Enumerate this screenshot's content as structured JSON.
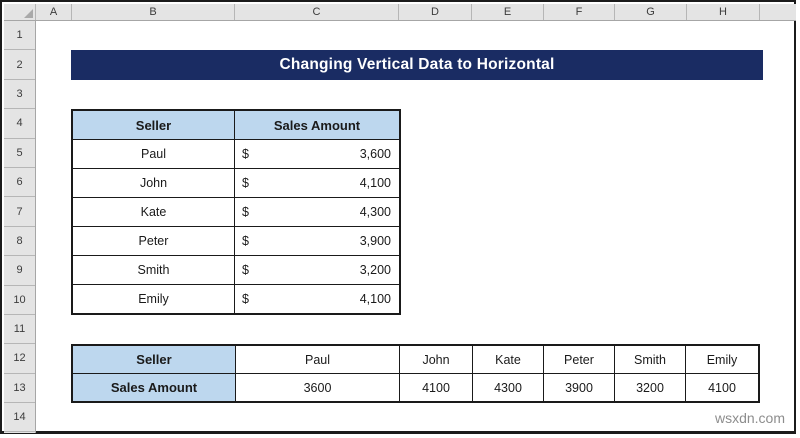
{
  "sheet": {
    "column_headers": [
      "A",
      "B",
      "C",
      "D",
      "E",
      "F",
      "G",
      "H",
      ""
    ],
    "row_headers": [
      "1",
      "2",
      "3",
      "4",
      "5",
      "6",
      "7",
      "8",
      "9",
      "10",
      "11",
      "12",
      "13",
      "14"
    ],
    "title_banner": {
      "text": "Changing Vertical Data to Horizontal"
    },
    "vertical_table": {
      "headers": [
        "Seller",
        "Sales Amount"
      ],
      "rows": [
        {
          "seller": "Paul",
          "currency": "$",
          "amount": "3,600"
        },
        {
          "seller": "John",
          "currency": "$",
          "amount": "4,100"
        },
        {
          "seller": "Kate",
          "currency": "$",
          "amount": "4,300"
        },
        {
          "seller": "Peter",
          "currency": "$",
          "amount": "3,900"
        },
        {
          "seller": "Smith",
          "currency": "$",
          "amount": "3,200"
        },
        {
          "seller": "Emily",
          "currency": "$",
          "amount": "4,100"
        }
      ]
    },
    "horizontal_table": {
      "label_sellers": "Seller",
      "label_amounts": "Sales Amount",
      "sellers": [
        "Paul",
        "John",
        "Kate",
        "Peter",
        "Smith",
        "Emily"
      ],
      "amounts": [
        "3600",
        "4100",
        "4300",
        "3900",
        "3200",
        "4100"
      ]
    },
    "colors": {
      "banner_bg": "#1a2c63",
      "banner_fg": "#ffffff",
      "header_cell_fill": "#bdd7ee",
      "table_border": "#1a1a1a",
      "gutter_fill": "#e4e4e4"
    }
  },
  "watermark": "wsxdn.com"
}
